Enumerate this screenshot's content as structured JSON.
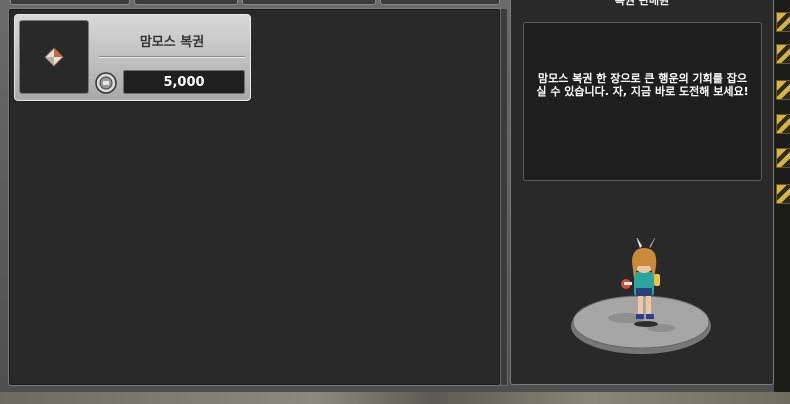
{
  "item": {
    "name": "맘모스 복권",
    "price": "5,000",
    "icon": "lottery-ticket-icon",
    "currency_icon": "coin-icon"
  },
  "npc": {
    "title": "복권 판매원",
    "description": "맘모스 복권 한 장으로 큰 행운의 기회를 잡으실 수 있습니다. 자, 지금 바로 도전해 보세요!"
  },
  "colors": {
    "panel_bg": "#2a2929",
    "card_bg": "#bdbdbd",
    "accent_gold": "#d7b43a"
  }
}
